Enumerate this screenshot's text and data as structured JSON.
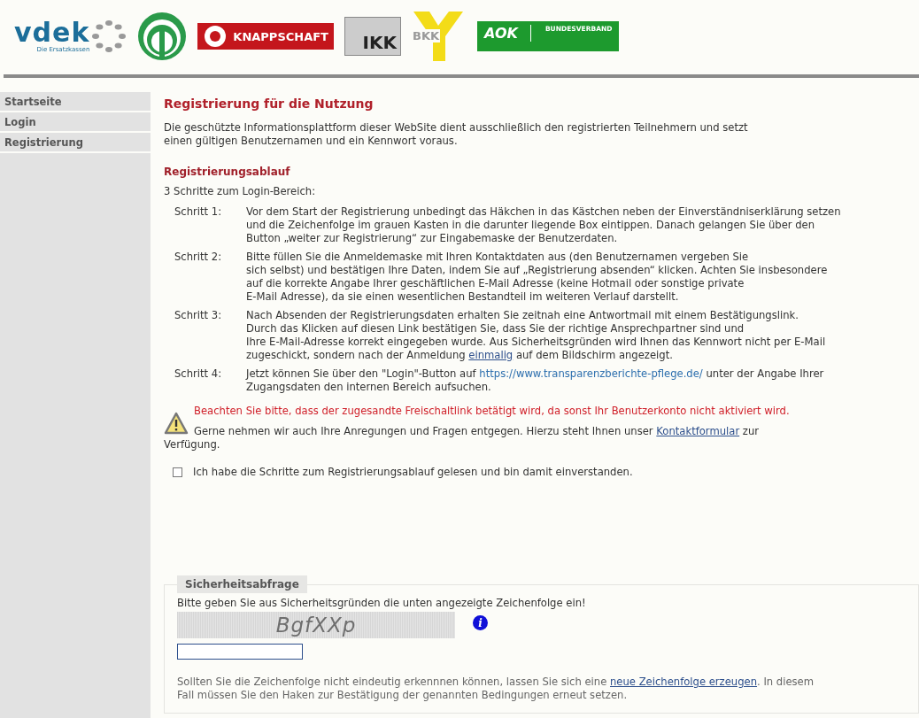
{
  "logos": [
    {
      "kind": "vdek",
      "text": "vdek",
      "subtitle": "Die Ersatzkassen"
    },
    {
      "kind": "green-circle"
    },
    {
      "kind": "knappschaft",
      "text": "KNAPPSCHAFT"
    },
    {
      "kind": "ikk",
      "text": "IKK"
    },
    {
      "kind": "bkk",
      "text": "BKK"
    },
    {
      "kind": "aok",
      "text": "AOK",
      "subtitle": "BUNDESVERBAND"
    }
  ],
  "sidebar": {
    "items": [
      {
        "label": "Startseite"
      },
      {
        "label": "Login"
      },
      {
        "label": "Registrierung"
      }
    ]
  },
  "title": "Registrierung für die Nutzung",
  "intro": [
    "Die geschützte Informationsplattform dieser WebSite dient ausschließlich den registrierten Teilnehmern und setzt",
    "einen gültigen Benutzernamen und ein Kennwort voraus."
  ],
  "section_title": "Registrierungsablauf",
  "steps_intro": "3 Schritte zum Login-Bereich:",
  "steps": [
    {
      "label": "Schritt 1:",
      "lines": [
        "Vor dem Start der Registrierung unbedingt das Häkchen in das Kästchen neben der Einverständniserklärung setzen",
        "und die Zeichenfolge im grauen Kasten in die darunter liegende Box eintippen. Danach gelangen Sie über den",
        "Button „weiter zur Registrierung“ zur Eingabemaske der Benutzerdaten."
      ]
    },
    {
      "label": "Schritt 2:",
      "lines": [
        "Bitte füllen Sie die Anmeldemaske mit Ihren Kontaktdaten aus (den Benutzernamen vergeben Sie",
        "sich selbst) und bestätigen Ihre Daten, indem Sie auf „Registrierung absenden“ klicken. Achten Sie insbesondere",
        "auf die korrekte Angabe Ihrer geschäftlichen E-Mail Adresse (keine Hotmail oder sonstige private",
        "E-Mail Adresse), da sie einen wesentlichen Bestandteil im weiteren Verlauf darstellt."
      ]
    },
    {
      "label": "Schritt 3:",
      "lines": [
        "Nach Absenden der Registrierungsdaten erhalten Sie zeitnah eine Antwortmail mit einem Bestätigungslink.",
        "Durch das Klicken auf diesen Link bestätigen Sie, dass Sie der richtige Ansprechpartner sind und",
        "Ihre E-Mail-Adresse korrekt eingegeben wurde. Aus Sicherheitsgründen wird Ihnen das Kennwort nicht per E-Mail",
        [
          {
            "kind": "text",
            "text": "zugeschickt, sondern nach der Anmeldung "
          },
          {
            "kind": "link",
            "text": "einmalig"
          },
          {
            "kind": "text",
            "text": " auf dem Bildschirm angezeigt."
          }
        ]
      ]
    },
    {
      "label": "Schritt 4:",
      "lines": [
        [
          {
            "kind": "text",
            "text": "Jetzt können Sie über den \"Login\"-Button auf "
          },
          {
            "kind": "url",
            "text": "https://www.transparenzberichte-pflege.de/"
          },
          {
            "kind": "text",
            "text": " unter der Angabe Ihrer"
          }
        ],
        "Zugangsdaten den internen Bereich aufsuchen."
      ]
    }
  ],
  "warning": "Beachten Sie bitte, dass der zugesandte Freischaltlink betätigt wird, da sonst Ihr Benutzerkonto nicht aktiviert wird.",
  "contact": [
    [
      {
        "kind": "text",
        "text": "Gerne nehmen wir auch Ihre Anregungen und Fragen entgegen. Hierzu steht Ihnen unser "
      },
      {
        "kind": "link",
        "text": "Kontaktformular"
      },
      {
        "kind": "text",
        "text": " zur"
      }
    ],
    "Verfügung."
  ],
  "consent": {
    "label": "Ich habe die Schritte zum Registrierungsablauf gelesen und bin damit einverstanden.",
    "checked": false
  },
  "security": {
    "legend": "Sicherheitsabfrage",
    "prompt": "Bitte geben Sie aus Sicherheitsgründen die unten angezeigte Zeichenfolge ein!",
    "captcha": "BgfXXp",
    "info_icon": "i",
    "note": [
      [
        {
          "kind": "text",
          "text": "Sollten Sie die Zeichenfolge nicht eindeutig erkennnen können, lassen Sie sich eine "
        },
        {
          "kind": "link",
          "text": "neue Zeichenfolge erzeugen"
        },
        {
          "kind": "text",
          "text": ". In diesem"
        }
      ],
      "Fall müssen Sie den Haken zur Bestätigung der genannten Bedingungen erneut setzen."
    ]
  }
}
